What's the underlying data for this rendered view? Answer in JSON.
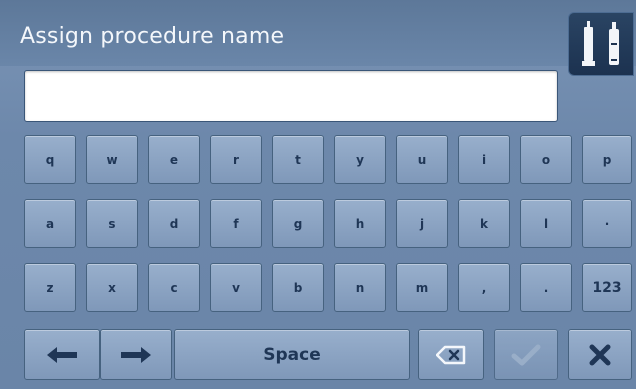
{
  "header": {
    "title": "Assign procedure name",
    "corner_icon": "clip-tools-icon"
  },
  "input": {
    "value": ""
  },
  "keyboard": {
    "row1": [
      "q",
      "w",
      "e",
      "r",
      "t",
      "y",
      "u",
      "i",
      "o",
      "p"
    ],
    "row2": [
      "a",
      "s",
      "d",
      "f",
      "g",
      "h",
      "j",
      "k",
      "l",
      "·"
    ],
    "row3": [
      "z",
      "x",
      "c",
      "v",
      "b",
      "n",
      "m",
      ",",
      ".",
      "123"
    ],
    "bottom": {
      "left_arrow_icon": "arrow-left-icon",
      "right_arrow_icon": "arrow-right-icon",
      "space": "Space",
      "backspace_icon": "backspace-icon",
      "confirm_icon": "checkmark-icon",
      "cancel_icon": "x-icon"
    }
  },
  "colors": {
    "background": "#6a85a8",
    "key": "#8ca4c3",
    "key_text": "#1f3656"
  }
}
